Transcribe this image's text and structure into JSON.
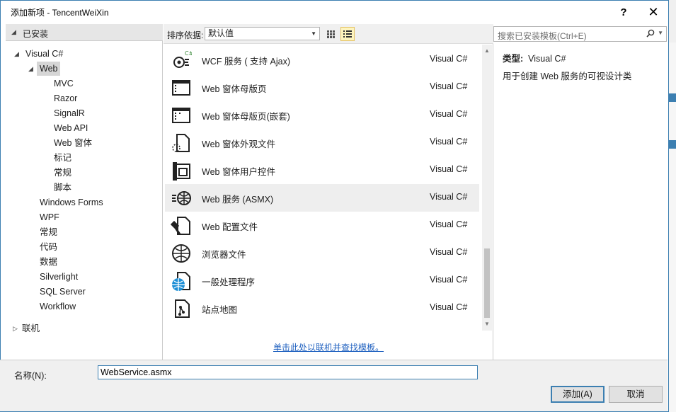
{
  "window": {
    "title": "添加新项 - TencentWeiXin",
    "help_glyph": "?",
    "close_glyph": "✕"
  },
  "left": {
    "header": "已安装",
    "tree": [
      {
        "label": "Visual C#",
        "level": 0,
        "expanded": true
      },
      {
        "label": "Web",
        "level": 1,
        "expanded": true,
        "selected": true
      },
      {
        "label": "MVC",
        "level": 2
      },
      {
        "label": "Razor",
        "level": 2
      },
      {
        "label": "SignalR",
        "level": 2
      },
      {
        "label": "Web API",
        "level": 2
      },
      {
        "label": "Web 窗体",
        "level": 2
      },
      {
        "label": "标记",
        "level": 2
      },
      {
        "label": "常规",
        "level": 2
      },
      {
        "label": "脚本",
        "level": 2
      },
      {
        "label": "Windows Forms",
        "level": 1
      },
      {
        "label": "WPF",
        "level": 1
      },
      {
        "label": "常规",
        "level": 1
      },
      {
        "label": "代码",
        "level": 1
      },
      {
        "label": "数据",
        "level": 1
      },
      {
        "label": "Silverlight",
        "level": 1
      },
      {
        "label": "SQL Server",
        "level": 1
      },
      {
        "label": "Workflow",
        "level": 1
      }
    ],
    "online": "联机"
  },
  "toolbar": {
    "sort_label": "排序依据:",
    "sort_value": "默认值"
  },
  "templates": [
    {
      "name": "WCF 服务 ( 支持 Ajax)",
      "lang": "Visual C#",
      "icon": "wcf-service-icon"
    },
    {
      "name": "Web 窗体母版页",
      "lang": "Visual C#",
      "icon": "master-page-icon"
    },
    {
      "name": "Web 窗体母版页(嵌套)",
      "lang": "Visual C#",
      "icon": "nested-master-page-icon"
    },
    {
      "name": "Web 窗体外观文件",
      "lang": "Visual C#",
      "icon": "skin-file-icon"
    },
    {
      "name": "Web 窗体用户控件",
      "lang": "Visual C#",
      "icon": "user-control-icon"
    },
    {
      "name": "Web 服务 (ASMX)",
      "lang": "Visual C#",
      "icon": "web-service-icon",
      "highlighted": true
    },
    {
      "name": "Web 配置文件",
      "lang": "Visual C#",
      "icon": "config-file-icon"
    },
    {
      "name": "浏览器文件",
      "lang": "Visual C#",
      "icon": "browser-file-icon"
    },
    {
      "name": "一般处理程序",
      "lang": "Visual C#",
      "icon": "generic-handler-icon"
    },
    {
      "name": "站点地图",
      "lang": "Visual C#",
      "icon": "sitemap-icon"
    }
  ],
  "online_link": "单击此处以联机并查找模板。",
  "search": {
    "placeholder": "搜索已安装模板(Ctrl+E)"
  },
  "details": {
    "type_label": "类型:",
    "type_value": "Visual C#",
    "description": "用于创建 Web 服务的可视设计类"
  },
  "bottom": {
    "name_label": "名称(N):",
    "name_value": "WebService.asmx",
    "add_label": "添加(A)",
    "cancel_label": "取消"
  },
  "colors": {
    "accent": "#3c7fb1",
    "link": "#1d5fbf",
    "highlight_row": "#eeeeee"
  }
}
